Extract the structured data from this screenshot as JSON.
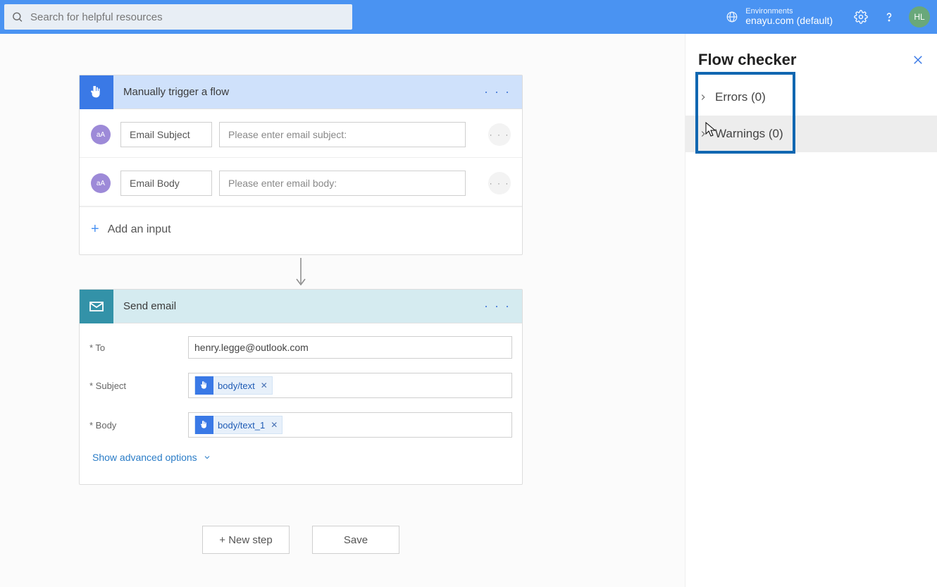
{
  "header": {
    "search_placeholder": "Search for helpful resources",
    "env_label": "Environments",
    "env_name": "enayu.com (default)",
    "avatar_initials": "HL"
  },
  "trigger_card": {
    "title": "Manually trigger a flow",
    "inputs": [
      {
        "label": "Email Subject",
        "placeholder": "Please enter email subject:"
      },
      {
        "label": "Email Body",
        "placeholder": "Please enter email body:"
      }
    ],
    "add_input_label": "Add an input"
  },
  "action_card": {
    "title": "Send email",
    "to_label": "* To",
    "to_value": "henry.legge@outlook.com",
    "subject_label": "* Subject",
    "subject_token": "body/text",
    "body_label": "* Body",
    "body_token": "body/text_1",
    "advanced_label": "Show advanced options"
  },
  "footer": {
    "new_step": "+ New step",
    "save": "Save"
  },
  "flow_checker": {
    "title": "Flow checker",
    "errors_label": "Errors (0)",
    "warnings_label": "Warnings (0)"
  }
}
